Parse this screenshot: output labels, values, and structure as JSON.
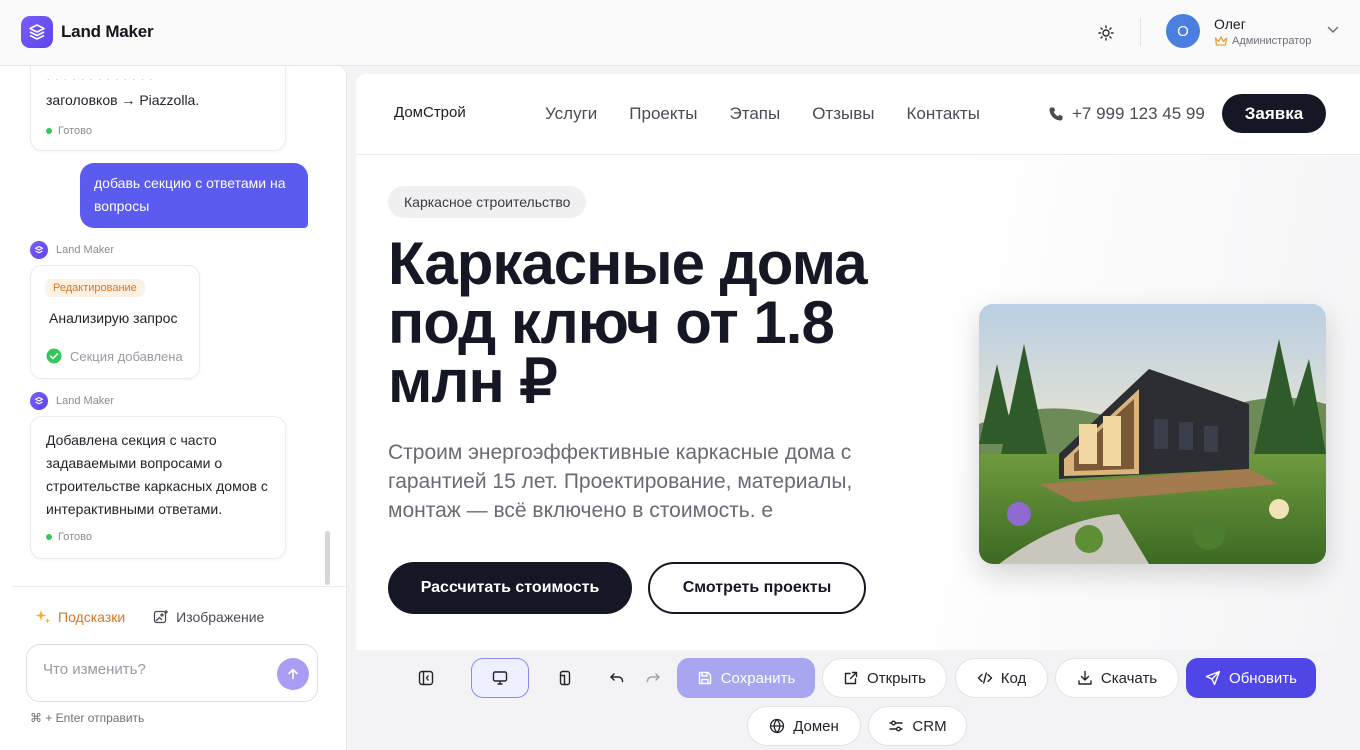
{
  "app": {
    "name": "Land Maker"
  },
  "user": {
    "name": "Олег",
    "initial": "О",
    "role": "Администратор"
  },
  "chat": {
    "messages": [
      {
        "type": "bot",
        "text_lines": [
          "заголовков → Piazzolla."
        ],
        "status": "Готово"
      },
      {
        "type": "user",
        "text": "добавь секцию с ответами на вопросы"
      },
      {
        "type": "bot-progress",
        "author": "Land Maker",
        "tag": "Редактирование",
        "title": "Анализирую запрос",
        "step": "Секция добавлена"
      },
      {
        "type": "bot",
        "author": "Land Maker",
        "text": "Добавлена секция с часто задаваемыми вопросами о строительстве каркасных домов с интерактивными ответами.",
        "status": "Готово"
      }
    ],
    "tabs": [
      {
        "label": "Подсказки",
        "icon": "sparkles-icon"
      },
      {
        "label": "Изображение",
        "icon": "image-add-icon"
      }
    ],
    "input": {
      "value": "",
      "placeholder": "Что изменить?"
    },
    "hint": "⌘ + Enter отправить"
  },
  "preview": {
    "site": {
      "logo": "ДомСтрой",
      "nav": [
        "Услуги",
        "Проекты",
        "Этапы",
        "Отзывы",
        "Контакты"
      ],
      "phone": "+7 999 123 45 99",
      "cta": "Заявка"
    },
    "hero": {
      "badge": "Каркасное строительство",
      "title": "Каркасные дома под ключ от 1.8 млн ₽",
      "subtitle": "Строим энергоэффективные каркасные дома с гарантией 15 лет. Проектирование, материалы, монтаж — всё включено в стоимость. е",
      "primary_button": "Рассчитать стоимость",
      "secondary_button": "Смотреть проекты"
    }
  },
  "toolbar": {
    "save": "Сохранить",
    "open": "Открыть",
    "code": "Код",
    "download": "Скачать",
    "update": "Обновить",
    "domain": "Домен",
    "crm": "CRM"
  },
  "colors": {
    "accent": "#5b5bf0",
    "update": "#4f46e5",
    "dark": "#151824",
    "warning": "#d9771f",
    "success": "#34c759"
  }
}
